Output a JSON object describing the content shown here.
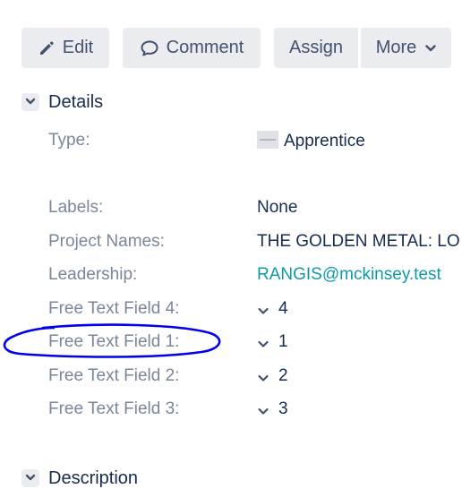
{
  "toolbar": {
    "edit_label": "Edit",
    "comment_label": "Comment",
    "assign_label": "Assign",
    "more_label": "More",
    "edit_icon": "pencil-icon",
    "comment_icon": "speech-bubble-icon",
    "more_icon": "chevron-down-icon"
  },
  "details": {
    "title": "Details",
    "fields": {
      "type": {
        "label": "Type:",
        "value": "Apprentice",
        "icon": "issue-type-icon"
      },
      "labels": {
        "label": "Labels:",
        "value": "None"
      },
      "project_names": {
        "label": "Project Names:",
        "value": "THE GOLDEN METAL: LO"
      },
      "leadership": {
        "label": "Leadership:",
        "value": "RANGIS@mckinsey.test"
      },
      "free_text_4": {
        "label": "Free Text Field 4:",
        "value": "4"
      },
      "free_text_1": {
        "label": "Free Text Field 1:",
        "value": "1"
      },
      "free_text_2": {
        "label": "Free Text Field 2:",
        "value": "2"
      },
      "free_text_3": {
        "label": "Free Text Field 3:",
        "value": "3"
      }
    }
  },
  "description": {
    "title": "Description"
  },
  "colors": {
    "button_bg": "#ebecf0",
    "label_text": "#7a869a",
    "link": "#0e9aa7",
    "annotation_circle": "#0000ff"
  }
}
